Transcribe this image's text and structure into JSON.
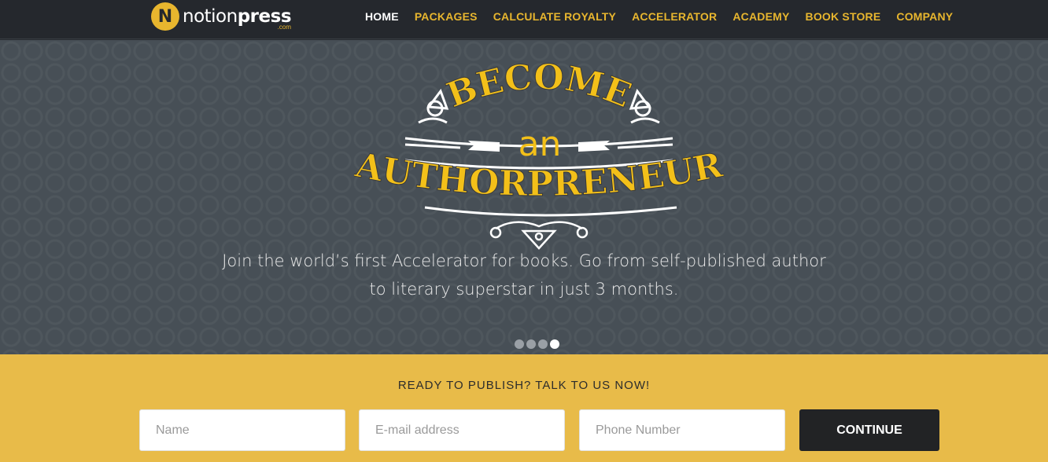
{
  "logo": {
    "badge": "N",
    "word_light": "notion",
    "word_bold": "press",
    "tld": ".com"
  },
  "nav": {
    "items": [
      {
        "label": "HOME",
        "active": true
      },
      {
        "label": "PACKAGES"
      },
      {
        "label": "CALCULATE ROYALTY"
      },
      {
        "label": "ACCELERATOR"
      },
      {
        "label": "ACADEMY"
      },
      {
        "label": "BOOK STORE"
      },
      {
        "label": "COMPANY"
      }
    ]
  },
  "hero": {
    "headline_top": "BECOME",
    "headline_mid": "an",
    "headline_bottom": "AUTHORPRENEUR",
    "tagline_line1": "Join the world’s first Accelerator for books. Go from self-published author",
    "tagline_line2": "to literary superstar in just 3 months.",
    "slides": 4,
    "active_slide": 4
  },
  "cta": {
    "heading": "READY TO PUBLISH? TALK TO US NOW!",
    "name_placeholder": "Name",
    "email_placeholder": "E-mail address",
    "phone_placeholder": "Phone Number",
    "button_label": "CONTINUE"
  },
  "colors": {
    "accent": "#e8b62e",
    "topbar": "#25282d",
    "hero_bg": "#474f56",
    "cta_bg": "#e8bb49",
    "button": "#222325"
  }
}
